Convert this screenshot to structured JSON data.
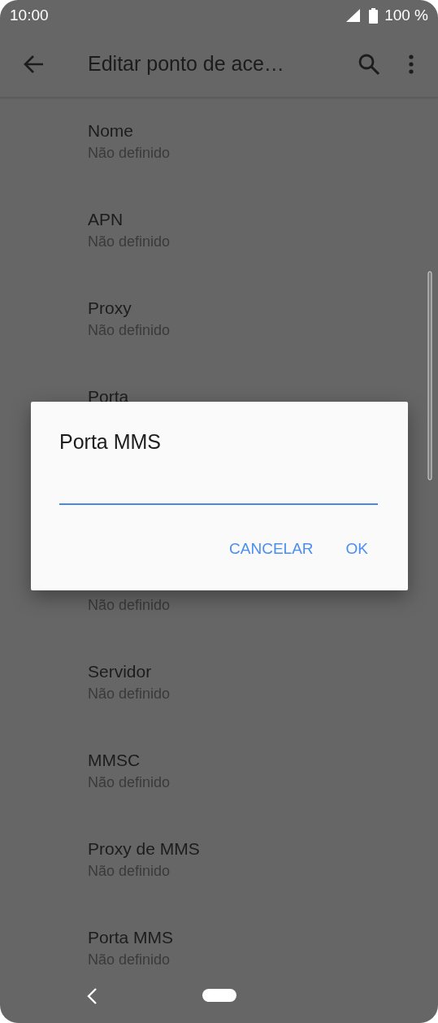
{
  "status_bar": {
    "time": "10:00",
    "battery": "100 %"
  },
  "app_bar": {
    "title": "Editar ponto de ace…"
  },
  "list_top": [
    {
      "title": "Nome",
      "value": "Não definido"
    },
    {
      "title": "APN",
      "value": "Não definido"
    },
    {
      "title": "Proxy",
      "value": "Não definido"
    },
    {
      "title": "Porta"
    }
  ],
  "list_bottom": [
    {
      "value": "Não definido"
    },
    {
      "title": "Servidor",
      "value": "Não definido"
    },
    {
      "title": "MMSC",
      "value": "Não definido"
    },
    {
      "title": "Proxy de MMS",
      "value": "Não definido"
    },
    {
      "title": "Porta MMS",
      "value": "Não definido"
    }
  ],
  "dialog": {
    "title": "Porta MMS",
    "buttons": [
      "CANCELAR",
      "OK"
    ]
  }
}
